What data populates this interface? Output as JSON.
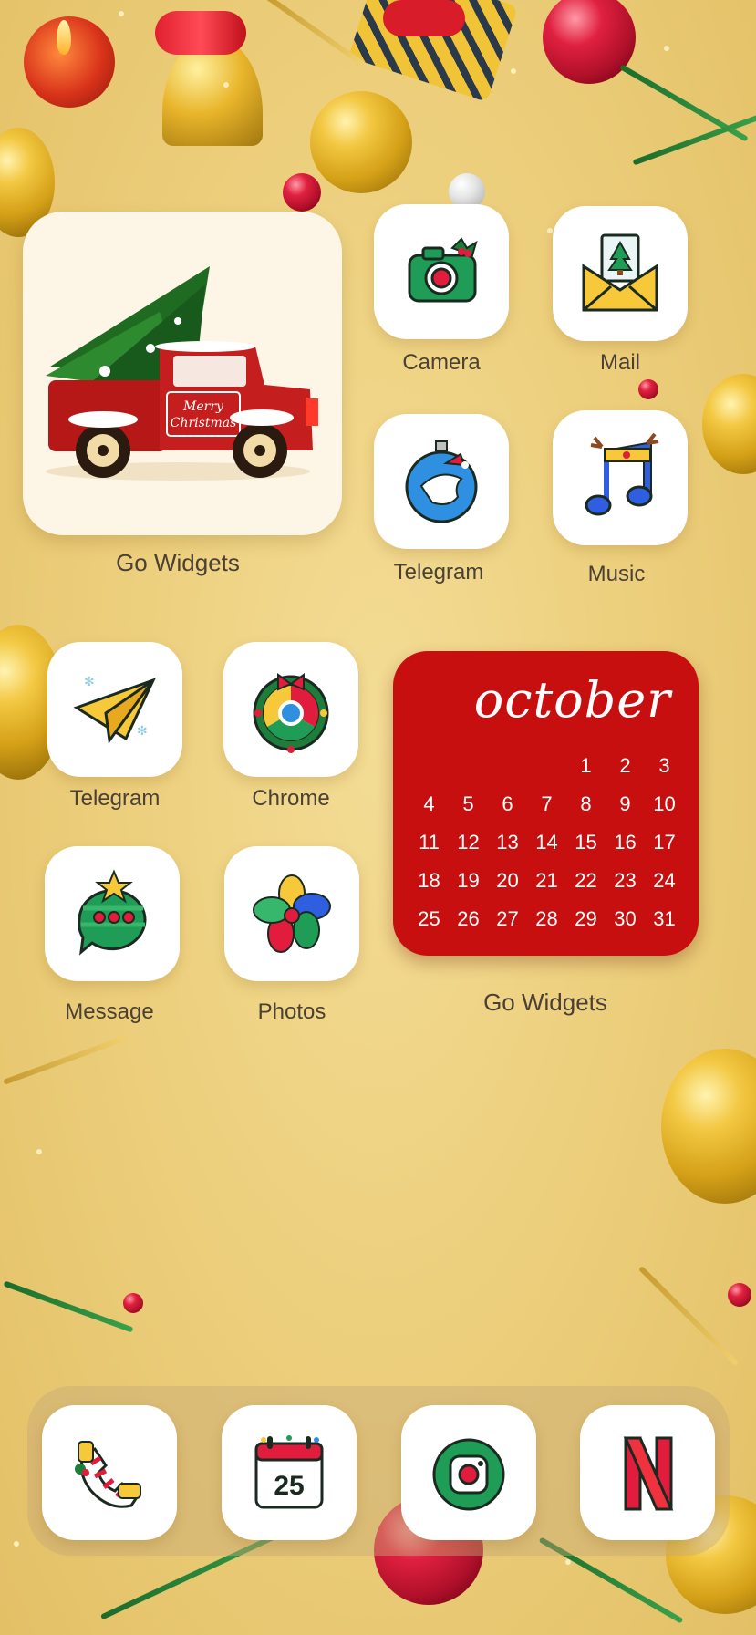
{
  "apps": {
    "camera": "Camera",
    "mail": "Mail",
    "telegram_1": "Telegram",
    "music": "Music",
    "telegram_2": "Telegram",
    "chrome": "Chrome",
    "message": "Message",
    "photos": "Photos"
  },
  "widgets": {
    "truck_label": "Go Widgets",
    "truck_sign": "Merry Christmas",
    "calendar_label": "Go Widgets"
  },
  "calendar": {
    "month": "october",
    "days": [
      "",
      "",
      "",
      "",
      "1",
      "2",
      "3",
      "4",
      "5",
      "6",
      "7",
      "8",
      "9",
      "10",
      "11",
      "12",
      "13",
      "14",
      "15",
      "16",
      "17",
      "18",
      "19",
      "20",
      "21",
      "22",
      "23",
      "24",
      "25",
      "26",
      "27",
      "28",
      "29",
      "30",
      "31"
    ]
  },
  "dock": {
    "calendar_icon_day": "25"
  },
  "colors": {
    "background": "#edd07e",
    "calendar_red": "#c80f0f",
    "label_text": "#4a4034"
  }
}
